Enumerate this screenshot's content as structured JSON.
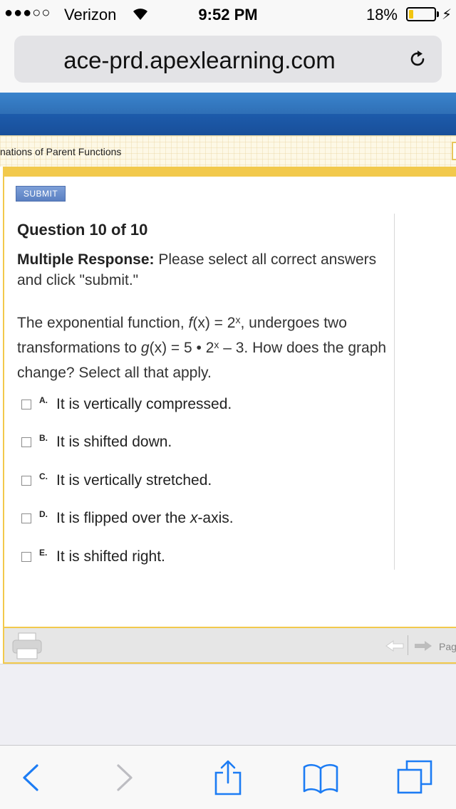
{
  "status_bar": {
    "signal": "●●●○○",
    "carrier": "Verizon",
    "time": "9:52 PM",
    "battery_percent": "18%",
    "battery_level": 0.18,
    "icons": [
      "wifi-icon",
      "battery-icon",
      "charging-icon"
    ]
  },
  "browser": {
    "url": "ace-prd.apexlearning.com",
    "reload_icon": "reload-icon"
  },
  "breadcrumb": "nations of Parent Functions",
  "submit_label": "SUBMIT",
  "question": {
    "heading": "Question 10 of 10",
    "type_label": "Multiple Response:",
    "instructions": "Please select all correct answers and click \"submit.\"",
    "prompt": {
      "intro": "The exponential function, ",
      "f_name": "f",
      "f_var": "(x)",
      "f_eq": " = 2",
      "f_exp": "x",
      "middle": ", undergoes two transformations to ",
      "g_name": "g",
      "g_var": "(x)",
      "g_eq": " = 5 • 2",
      "g_exp": "x",
      "after_g": " – 3. How does the graph change? Select all that apply."
    },
    "options": [
      {
        "letter": "A.",
        "text": "It is vertically compressed.",
        "checked": false
      },
      {
        "letter": "B.",
        "text": "It is shifted down.",
        "checked": false
      },
      {
        "letter": "C.",
        "text": "It is vertically stretched.",
        "checked": false
      },
      {
        "letter": "D.",
        "text_before": "It is flipped over the ",
        "text_italic": "x",
        "text_after": "-axis.",
        "checked": false
      },
      {
        "letter": "E.",
        "text": "It is shifted right.",
        "checked": false
      }
    ]
  },
  "toolbar": {
    "page_label": "Pag",
    "icons": [
      "print-icon",
      "back-arrow-icon",
      "forward-arrow-icon"
    ]
  },
  "safari_toolbar": {
    "icons": [
      "back-icon",
      "forward-icon",
      "share-icon",
      "bookmarks-icon",
      "tabs-icon"
    ]
  },
  "colors": {
    "banner_blue": "#2f6fb6",
    "frame_yellow": "#f2c94c",
    "submit_blue": "#6a8fcf"
  }
}
